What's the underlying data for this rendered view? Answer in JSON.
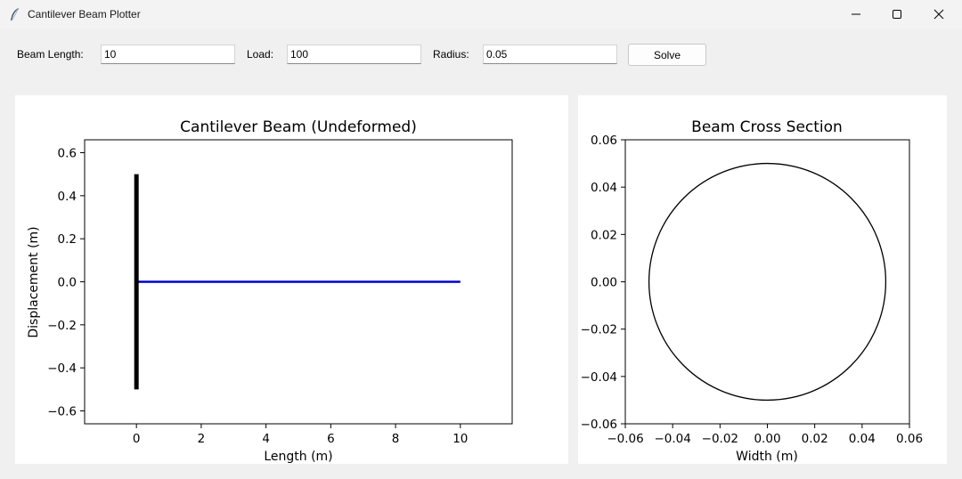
{
  "window": {
    "title": "Cantilever Beam Plotter",
    "controls": [
      "minimize-icon",
      "maximize-icon",
      "close-icon"
    ]
  },
  "toolbar": {
    "beam_length_label": "Beam Length:",
    "beam_length_value": "10",
    "load_label": "Load:",
    "load_value": "100",
    "radius_label": "Radius:",
    "radius_value": "0.05",
    "solve_label": "Solve"
  },
  "chart_data": [
    {
      "type": "line",
      "title": "Cantilever Beam (Undeformed)",
      "xlabel": "Length (m)",
      "ylabel": "Displacement (m)",
      "xlim": [
        -1.6,
        11.6
      ],
      "ylim": [
        -0.66,
        0.66
      ],
      "xticks": [
        0,
        2,
        4,
        6,
        8,
        10
      ],
      "yticks": [
        -0.6,
        -0.4,
        -0.2,
        0.0,
        0.2,
        0.4,
        0.6
      ],
      "xtick_labels": [
        "0",
        "2",
        "4",
        "6",
        "8",
        "10"
      ],
      "ytick_labels": [
        "−0.6",
        "−0.4",
        "−0.2",
        "0.0",
        "0.2",
        "0.4",
        "0.6"
      ],
      "grid": false,
      "series": [
        {
          "x": [
            0,
            10
          ],
          "y": [
            0,
            0
          ],
          "color": "#0000cc"
        },
        {
          "x": [
            0,
            0
          ],
          "y": [
            -0.5,
            0.5
          ],
          "color": "#000000"
        }
      ]
    },
    {
      "type": "line",
      "title": "Beam Cross Section",
      "xlabel": "Width (m)",
      "ylabel": "",
      "xlim": [
        -0.06,
        0.06
      ],
      "ylim": [
        -0.06,
        0.06
      ],
      "xticks": [
        -0.06,
        -0.04,
        -0.02,
        0.0,
        0.02,
        0.04,
        0.06
      ],
      "yticks": [
        -0.06,
        -0.04,
        -0.02,
        0.0,
        0.02,
        0.04,
        0.06
      ],
      "xtick_labels": [
        "−0.06",
        "−0.04",
        "−0.02",
        "0.00",
        "0.02",
        "0.04",
        "0.06"
      ],
      "ytick_labels": [
        "−0.06",
        "−0.04",
        "−0.02",
        "0.00",
        "0.02",
        "0.04",
        "0.06"
      ],
      "grid": false,
      "series": [
        {
          "shape": "circle",
          "center": [
            0,
            0
          ],
          "radius": 0.05,
          "color": "#000000"
        }
      ]
    }
  ]
}
